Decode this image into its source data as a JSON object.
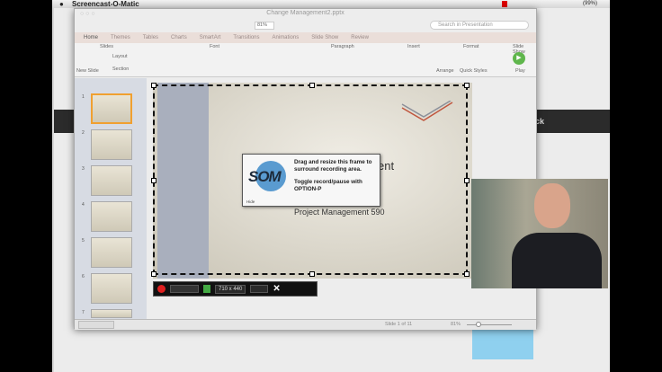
{
  "menubar": {
    "app": "Screencast-O-Matic",
    "battery": "(99%)"
  },
  "window": {
    "title": "Change Management2.pptx",
    "zoom": "81%",
    "search_placeholder": "Search in Presentation"
  },
  "tabs": [
    "Home",
    "Themes",
    "Tables",
    "Charts",
    "SmartArt",
    "Transitions",
    "Animations",
    "Slide Show",
    "Review"
  ],
  "ribbon": {
    "groups": [
      "Slides",
      "Font",
      "Paragraph",
      "Insert",
      "Format",
      "Slide Show"
    ],
    "new_slide": "New Slide",
    "layout": "Layout",
    "section": "Section",
    "arrange": "Arrange",
    "quick_styles": "Quick Styles",
    "play": "Play"
  },
  "thumbnails": [
    "1",
    "2",
    "3",
    "4",
    "5",
    "6",
    "7"
  ],
  "slide": {
    "title_fragment": "ent",
    "subtitle": "Project Management 590"
  },
  "som_tip": {
    "logo": "SOM",
    "line1": "Drag and resize this frame to surround recording area.",
    "line2": "Toggle record/pause with OPTION-P",
    "hide": "Hide"
  },
  "recorder": {
    "size": "710 x 440"
  },
  "status": {
    "slide": "Slide 1 of 11",
    "zoom": "81%"
  },
  "background_page": {
    "band_text": "ck"
  },
  "colors": {
    "record": "#e02020",
    "tabs_bg": "#eaded9"
  }
}
